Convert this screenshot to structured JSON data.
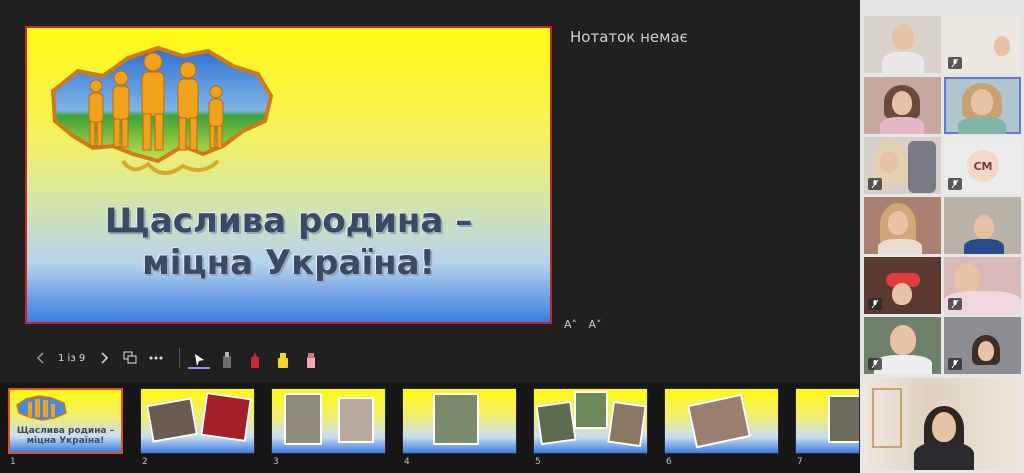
{
  "slide": {
    "title_line1": "Щаслива родина –",
    "title_line2": "міцна Україна!"
  },
  "notes": {
    "empty_text": "Нотаток немає"
  },
  "font_controls": {
    "increase": "A˄",
    "decrease": "A˅"
  },
  "toolbar": {
    "page_counter": "1 із 9",
    "tools": [
      "pointer",
      "eraser",
      "red-pen",
      "highlighter",
      "pink-eraser"
    ]
  },
  "thumbnails": [
    {
      "number": "1",
      "title": "Щаслива родина – міцна Україна!",
      "active": true
    },
    {
      "number": "2",
      "active": false
    },
    {
      "number": "3",
      "active": false
    },
    {
      "number": "4",
      "active": false
    },
    {
      "number": "5",
      "active": false
    },
    {
      "number": "6",
      "active": false
    },
    {
      "number": "7",
      "active": false
    }
  ],
  "participants": {
    "initials_tile": "СМ"
  },
  "colors": {
    "accent": "#6a73d8",
    "active_thumb_border": "#d9541e",
    "slide_border": "#c0282a"
  }
}
